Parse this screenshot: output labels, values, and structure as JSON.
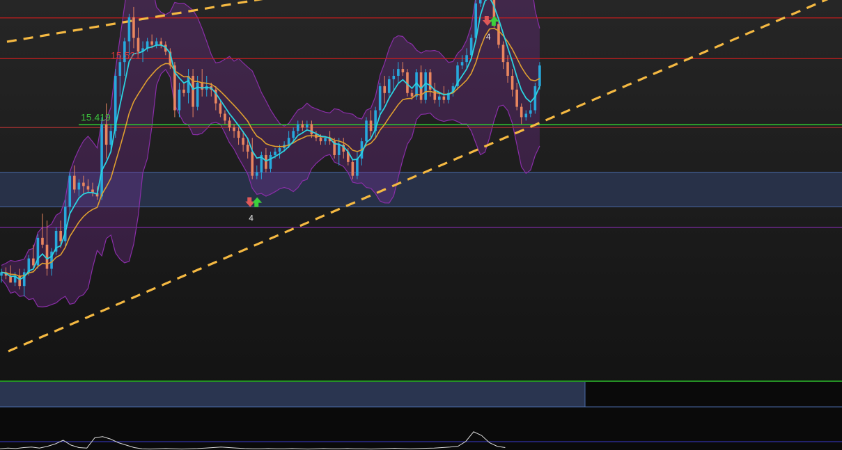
{
  "chart_data": {
    "type": "candlestick",
    "title": "",
    "xlabel": "",
    "ylabel": "",
    "ylim": [
      15.05,
      15.6
    ],
    "grid": false,
    "colors": {
      "background": "#111111",
      "up_candle": "#27a8dc",
      "down_candle": "#e9865f",
      "ema_fast": "#2bd3e0",
      "ema_slow": "#e0a030",
      "bollinger": "#8a2ea8",
      "trendline": "#f5b942",
      "resistance": "#c81e1e",
      "support": "#2ec02e",
      "zone": "#2a3550"
    },
    "price_labels": [
      {
        "text": "15.521",
        "value": 15.52,
        "color": "#d23a3a"
      },
      {
        "text": "15.419",
        "value": 15.419,
        "color": "#3cbf3c"
      }
    ],
    "levels": [
      {
        "name": "resistance-upper",
        "value": 15.574,
        "color": "#c81e1e"
      },
      {
        "name": "resistance-lower",
        "value": 15.515,
        "color": "#c81e1e"
      },
      {
        "name": "support",
        "value": 15.419,
        "color": "#2ec02e"
      },
      {
        "name": "support-thin",
        "value": 15.415,
        "color": "#a03030"
      },
      {
        "name": "purple-level",
        "value": 15.27,
        "color": "#7a2aa0"
      }
    ],
    "zones": [
      {
        "name": "demand-zone",
        "from": 15.3,
        "to": 15.35
      }
    ],
    "signals": [
      {
        "name": "signal-mid",
        "candle": 55,
        "count": "4"
      },
      {
        "name": "signal-top",
        "candle": 107,
        "count": "4"
      }
    ],
    "candles": [
      [
        15.2,
        15.21,
        15.19,
        15.205
      ],
      [
        15.205,
        15.212,
        15.195,
        15.2
      ],
      [
        15.2,
        15.215,
        15.19,
        15.19
      ],
      [
        15.19,
        15.205,
        15.185,
        15.2
      ],
      [
        15.2,
        15.21,
        15.18,
        15.185
      ],
      [
        15.185,
        15.21,
        15.17,
        15.205
      ],
      [
        15.205,
        15.23,
        15.2,
        15.225
      ],
      [
        15.225,
        15.245,
        15.21,
        15.215
      ],
      [
        15.215,
        15.26,
        15.21,
        15.255
      ],
      [
        15.255,
        15.29,
        15.24,
        15.245
      ],
      [
        15.245,
        15.28,
        15.2,
        15.21
      ],
      [
        15.21,
        15.24,
        15.2,
        15.235
      ],
      [
        15.235,
        15.27,
        15.23,
        15.265
      ],
      [
        15.265,
        15.28,
        15.24,
        15.25
      ],
      [
        15.25,
        15.31,
        15.24,
        15.3
      ],
      [
        15.3,
        15.35,
        15.29,
        15.345
      ],
      [
        15.345,
        15.36,
        15.32,
        15.325
      ],
      [
        15.325,
        15.34,
        15.315,
        15.335
      ],
      [
        15.335,
        15.345,
        15.32,
        15.33
      ],
      [
        15.33,
        15.34,
        15.32,
        15.325
      ],
      [
        15.325,
        15.335,
        15.315,
        15.32
      ],
      [
        15.32,
        15.33,
        15.31,
        15.315
      ],
      [
        15.315,
        15.43,
        15.31,
        15.42
      ],
      [
        15.42,
        15.45,
        15.37,
        15.39
      ],
      [
        15.39,
        15.42,
        15.38,
        15.41
      ],
      [
        15.41,
        15.5,
        15.4,
        15.49
      ],
      [
        15.49,
        15.52,
        15.46,
        15.51
      ],
      [
        15.51,
        15.545,
        15.49,
        15.54
      ],
      [
        15.54,
        15.58,
        15.52,
        15.575
      ],
      [
        15.575,
        15.59,
        15.53,
        15.545
      ],
      [
        15.545,
        15.56,
        15.52,
        15.525
      ],
      [
        15.525,
        15.54,
        15.51,
        15.53
      ],
      [
        15.53,
        15.545,
        15.525,
        15.54
      ],
      [
        15.54,
        15.55,
        15.53,
        15.535
      ],
      [
        15.535,
        15.545,
        15.53,
        15.54
      ],
      [
        15.54,
        15.545,
        15.53,
        15.535
      ],
      [
        15.535,
        15.54,
        15.52,
        15.525
      ],
      [
        15.525,
        15.53,
        15.5,
        15.505
      ],
      [
        15.505,
        15.51,
        15.43,
        15.44
      ],
      [
        15.44,
        15.48,
        15.43,
        15.47
      ],
      [
        15.47,
        15.48,
        15.46,
        15.465
      ],
      [
        15.465,
        15.5,
        15.45,
        15.49
      ],
      [
        15.49,
        15.5,
        15.43,
        15.445
      ],
      [
        15.445,
        15.49,
        15.44,
        15.48
      ],
      [
        15.48,
        15.5,
        15.46,
        15.47
      ],
      [
        15.47,
        15.49,
        15.46,
        15.475
      ],
      [
        15.475,
        15.48,
        15.46,
        15.47
      ],
      [
        15.47,
        15.475,
        15.44,
        15.45
      ],
      [
        15.45,
        15.455,
        15.43,
        15.435
      ],
      [
        15.435,
        15.44,
        15.42,
        15.425
      ],
      [
        15.425,
        15.43,
        15.41,
        15.415
      ],
      [
        15.415,
        15.42,
        15.4,
        15.41
      ],
      [
        15.41,
        15.415,
        15.39,
        15.4
      ],
      [
        15.4,
        15.41,
        15.38,
        15.39
      ],
      [
        15.39,
        15.4,
        15.37,
        15.38
      ],
      [
        15.38,
        15.4,
        15.34,
        15.345
      ],
      [
        15.345,
        15.36,
        15.34,
        15.35
      ],
      [
        15.35,
        15.38,
        15.34,
        15.375
      ],
      [
        15.375,
        15.385,
        15.35,
        15.355
      ],
      [
        15.355,
        15.38,
        15.35,
        15.375
      ],
      [
        15.375,
        15.385,
        15.37,
        15.38
      ],
      [
        15.38,
        15.39,
        15.37,
        15.385
      ],
      [
        15.385,
        15.395,
        15.38,
        15.39
      ],
      [
        15.39,
        15.41,
        15.385,
        15.4
      ],
      [
        15.4,
        15.415,
        15.395,
        15.41
      ],
      [
        15.41,
        15.425,
        15.405,
        15.42
      ],
      [
        15.42,
        15.425,
        15.41,
        15.415
      ],
      [
        15.415,
        15.425,
        15.41,
        15.42
      ],
      [
        15.42,
        15.425,
        15.4,
        15.405
      ],
      [
        15.405,
        15.41,
        15.395,
        15.4
      ],
      [
        15.4,
        15.405,
        15.39,
        15.395
      ],
      [
        15.395,
        15.4,
        15.39,
        15.4
      ],
      [
        15.4,
        15.41,
        15.39,
        15.395
      ],
      [
        15.395,
        15.4,
        15.37,
        15.375
      ],
      [
        15.375,
        15.4,
        15.36,
        15.39
      ],
      [
        15.39,
        15.4,
        15.37,
        15.38
      ],
      [
        15.38,
        15.385,
        15.36,
        15.365
      ],
      [
        15.365,
        15.37,
        15.34,
        15.345
      ],
      [
        15.345,
        15.38,
        15.34,
        15.37
      ],
      [
        15.37,
        15.4,
        15.36,
        15.395
      ],
      [
        15.395,
        15.43,
        15.39,
        15.425
      ],
      [
        15.425,
        15.44,
        15.4,
        15.41
      ],
      [
        15.41,
        15.445,
        15.4,
        15.44
      ],
      [
        15.44,
        15.48,
        15.43,
        15.475
      ],
      [
        15.475,
        15.49,
        15.45,
        15.465
      ],
      [
        15.465,
        15.49,
        15.46,
        15.485
      ],
      [
        15.485,
        15.5,
        15.47,
        15.49
      ],
      [
        15.49,
        15.51,
        15.48,
        15.5
      ],
      [
        15.5,
        15.51,
        15.49,
        15.495
      ],
      [
        15.495,
        15.5,
        15.46,
        15.465
      ],
      [
        15.465,
        15.47,
        15.455,
        15.46
      ],
      [
        15.46,
        15.5,
        15.455,
        15.495
      ],
      [
        15.495,
        15.505,
        15.45,
        15.455
      ],
      [
        15.455,
        15.5,
        15.45,
        15.495
      ],
      [
        15.495,
        15.5,
        15.46,
        15.47
      ],
      [
        15.47,
        15.48,
        15.45,
        15.455
      ],
      [
        15.455,
        15.465,
        15.445,
        15.46
      ],
      [
        15.46,
        15.475,
        15.45,
        15.455
      ],
      [
        15.455,
        15.47,
        15.45,
        15.465
      ],
      [
        15.465,
        15.48,
        15.46,
        15.475
      ],
      [
        15.475,
        15.51,
        15.47,
        15.505
      ],
      [
        15.505,
        15.52,
        15.5,
        15.51
      ],
      [
        15.51,
        15.53,
        15.5,
        15.52
      ],
      [
        15.52,
        15.55,
        15.515,
        15.545
      ],
      [
        15.545,
        15.6,
        15.54,
        15.595
      ],
      [
        15.595,
        15.66,
        15.59,
        15.65
      ],
      [
        15.65,
        15.68,
        15.62,
        15.64
      ],
      [
        15.64,
        15.66,
        15.61,
        15.615
      ],
      [
        15.615,
        15.62,
        15.56,
        15.565
      ],
      [
        15.565,
        15.57,
        15.53,
        15.535
      ],
      [
        15.535,
        15.54,
        15.5,
        15.51
      ],
      [
        15.51,
        15.52,
        15.48,
        15.49
      ],
      [
        15.49,
        15.5,
        15.46,
        15.47
      ],
      [
        15.47,
        15.48,
        15.44,
        15.445
      ],
      [
        15.445,
        15.45,
        15.42,
        15.43
      ],
      [
        15.43,
        15.44,
        15.425,
        15.435
      ],
      [
        15.435,
        15.45,
        15.43,
        15.44
      ],
      [
        15.44,
        15.48,
        15.435,
        15.475
      ],
      [
        15.475,
        15.51,
        15.47,
        15.505
      ]
    ],
    "indicator": {
      "name": "oscillator",
      "points": [
        0.05,
        0.08,
        0.06,
        0.1,
        0.12,
        0.08,
        0.15,
        0.25,
        0.4,
        0.2,
        0.1,
        0.08,
        0.5,
        0.55,
        0.45,
        0.3,
        0.2,
        0.1,
        0.05,
        0.04,
        0.05,
        0.06,
        0.05,
        0.04,
        0.05,
        0.06,
        0.08,
        0.1,
        0.12,
        0.1,
        0.08,
        0.06,
        0.05,
        0.05,
        0.06,
        0.05,
        0.05,
        0.06,
        0.05,
        0.04,
        0.05,
        0.06,
        0.05,
        0.05,
        0.06,
        0.05,
        0.05,
        0.04,
        0.05,
        0.06,
        0.07,
        0.06,
        0.05,
        0.06,
        0.07,
        0.08,
        0.1,
        0.12,
        0.15,
        0.35,
        0.75,
        0.6,
        0.3,
        0.15,
        0.1
      ]
    }
  }
}
